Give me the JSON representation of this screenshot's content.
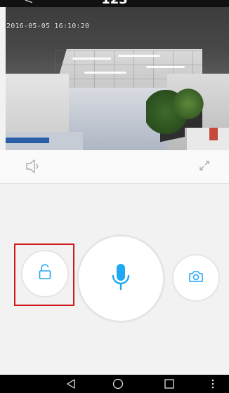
{
  "header": {
    "title": "123",
    "back_icon": "chevron-left-icon"
  },
  "video": {
    "timestamp": "2016-05-05 16:10:20"
  },
  "controls": {
    "speaker_icon": "speaker-icon",
    "fullscreen_icon": "fullscreen-icon"
  },
  "actions": {
    "unlock_icon": "unlock-icon",
    "mic_icon": "microphone-icon",
    "camera_icon": "camera-icon"
  },
  "navigation": {
    "back_icon": "triangle-back-icon",
    "home_icon": "circle-home-icon",
    "recent_icon": "square-recent-icon",
    "menu_icon": "vertical-dots-icon"
  },
  "colors": {
    "accent": "#1ea7f2",
    "highlight": "#d1181a"
  }
}
